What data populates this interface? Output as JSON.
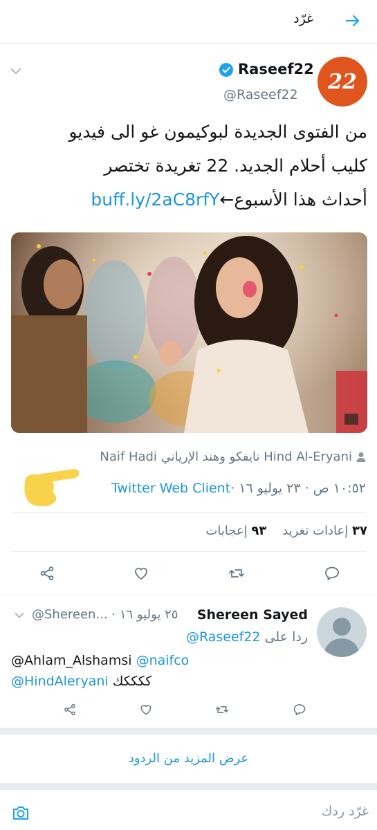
{
  "header": {
    "title": "غرّد",
    "back_icon": "arrow-right-icon"
  },
  "tweet": {
    "author_name": "Raseef22",
    "author_handle": "@Raseef22",
    "avatar_text": "22",
    "avatar_color": "#e0541e",
    "verified_color": "#1da1f2",
    "text_line1": "من الفتوى الجديدة لبوكيمون غو الى فيديو",
    "text_line2": "كليب أحلام الجديد. 22 تغريدة تختصر",
    "text_line3_text": "أحداث هذا الأسبوع←",
    "text_line3_link": "buff.ly/2aC8rfY",
    "tagged_users": "Naif Hadi نايفكو وهند الإرياني Hind Al-Eryani",
    "time_prefix": "١٠:٥٢ ص · ٢٣ يوليو ١٦ · ",
    "client": "Twitter Web Client",
    "retweets_count": "٣٧",
    "retweets_label": "إعادات تغريد",
    "likes_count": "٩٣",
    "likes_label": "إعجابات"
  },
  "reply": {
    "author_name": "Shereen Sayed",
    "handle_date": "@Shereen... · ٢٥ يوليو ١٦",
    "replying_prefix": "ردا على",
    "replying_to": "@Raseef22",
    "mention1": "@naifco",
    "mention2": "@Ahlam_Alshamsi",
    "mention3": "@HindAleryani",
    "text": "ككككك"
  },
  "more_replies": "عرض المزيد من الردود",
  "compose": {
    "placeholder": "غرّد ردك"
  }
}
